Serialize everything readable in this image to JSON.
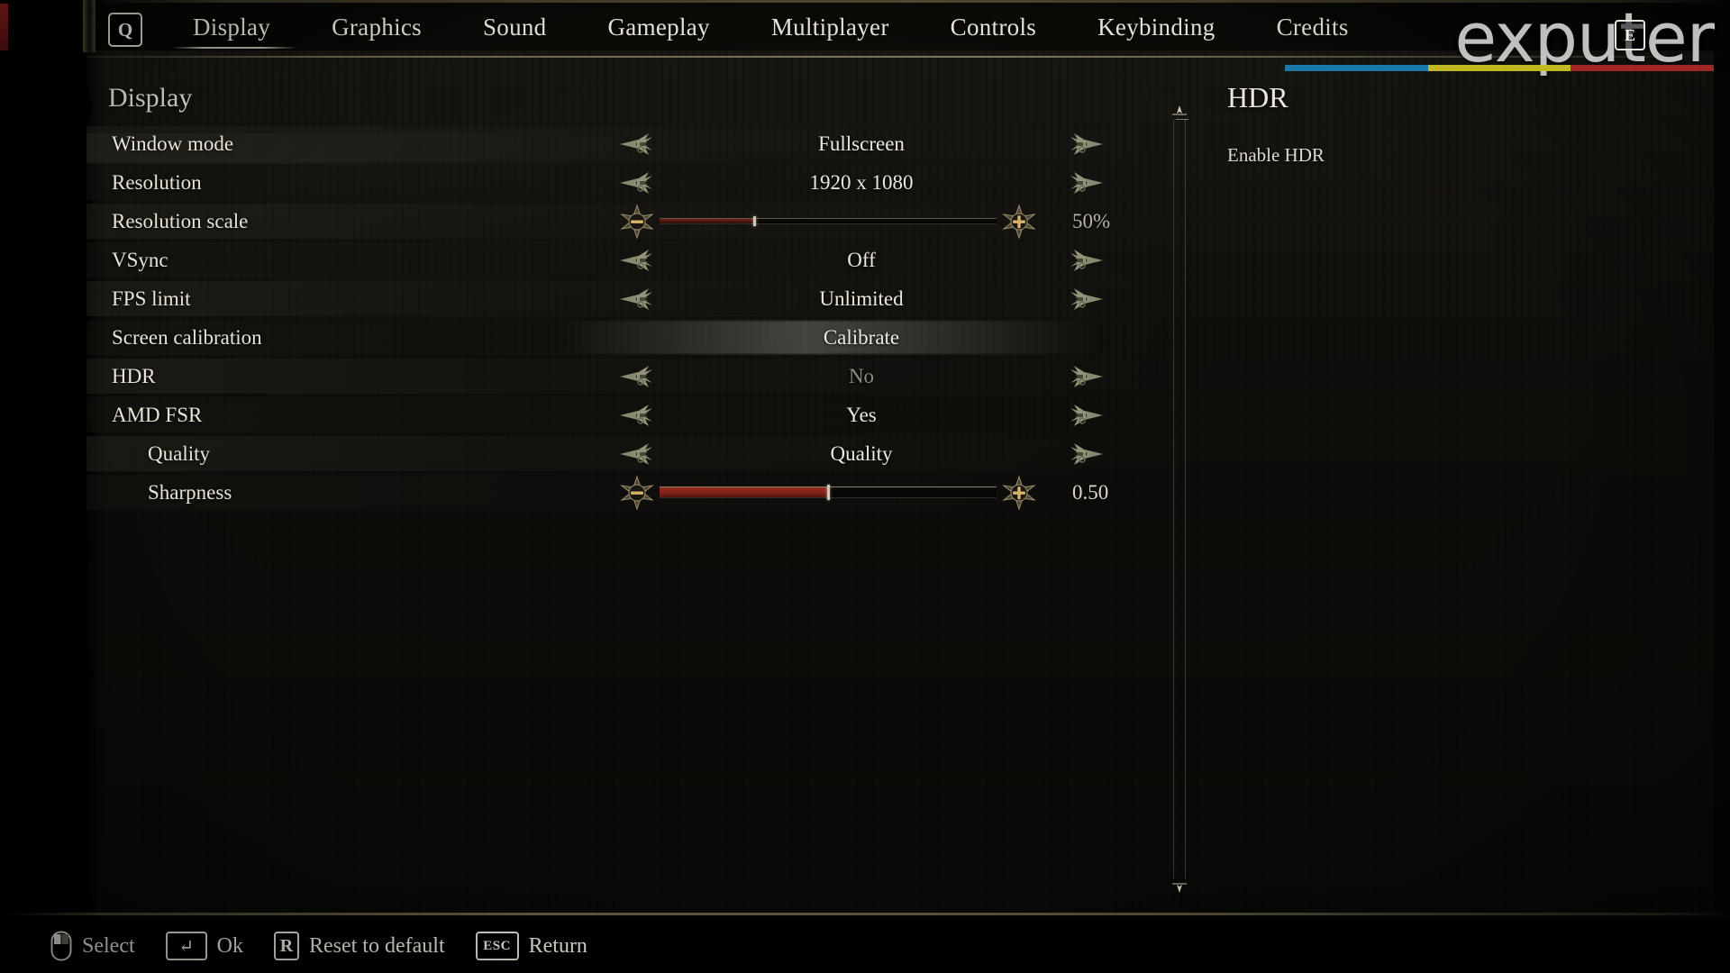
{
  "window": {
    "qkey_label": "Q",
    "ekey_label": "E"
  },
  "watermark": {
    "text": "exputer",
    "bar_colors": [
      "#1a86c0",
      "#d8d124",
      "#b52a2a"
    ]
  },
  "tabs": [
    {
      "label": "Display",
      "active": true
    },
    {
      "label": "Graphics",
      "active": false
    },
    {
      "label": "Sound",
      "active": false
    },
    {
      "label": "Gameplay",
      "active": false
    },
    {
      "label": "Multiplayer",
      "active": false
    },
    {
      "label": "Controls",
      "active": false
    },
    {
      "label": "Keybinding",
      "active": false
    },
    {
      "label": "Credits",
      "active": false
    }
  ],
  "section": {
    "title": "Display"
  },
  "settings": [
    {
      "label": "Window mode",
      "type": "selector",
      "value": "Fullscreen",
      "indent": 1,
      "dim": false
    },
    {
      "label": "Resolution",
      "type": "selector",
      "value": "1920 x 1080",
      "indent": 1,
      "dim": false
    },
    {
      "label": "Resolution scale",
      "type": "slider",
      "value": "50%",
      "indent": 1,
      "fill_percent": 28,
      "highlighted": false
    },
    {
      "label": "VSync",
      "type": "selector",
      "value": "Off",
      "indent": 1,
      "dim": false
    },
    {
      "label": "FPS limit",
      "type": "selector",
      "value": "Unlimited",
      "indent": 1,
      "dim": false
    },
    {
      "label": "Screen calibration",
      "type": "action",
      "value": "Calibrate",
      "indent": 1,
      "dim": false
    },
    {
      "label": "HDR",
      "type": "selector",
      "value": "No",
      "indent": 1,
      "dim": true
    },
    {
      "label": "AMD FSR",
      "type": "selector",
      "value": "Yes",
      "indent": 1,
      "dim": false
    },
    {
      "label": "Quality",
      "type": "selector",
      "value": "Quality",
      "indent": 2,
      "dim": false
    },
    {
      "label": "Sharpness",
      "type": "slider",
      "value": "0.50",
      "indent": 2,
      "fill_percent": 50,
      "highlighted": true
    }
  ],
  "info": {
    "title": "HDR",
    "description": "Enable HDR"
  },
  "footer": [
    {
      "key": "mouse",
      "label": "Select"
    },
    {
      "key": "↵",
      "label": "Ok"
    },
    {
      "key": "R",
      "label": "Reset to default"
    },
    {
      "key": "ESC",
      "label": "Return"
    }
  ],
  "colors": {
    "accent_fill": "#6e2019",
    "accent_fill_bright": "#a02a20",
    "text": "#e7e3d6",
    "text_dim": "#8d8a80"
  }
}
